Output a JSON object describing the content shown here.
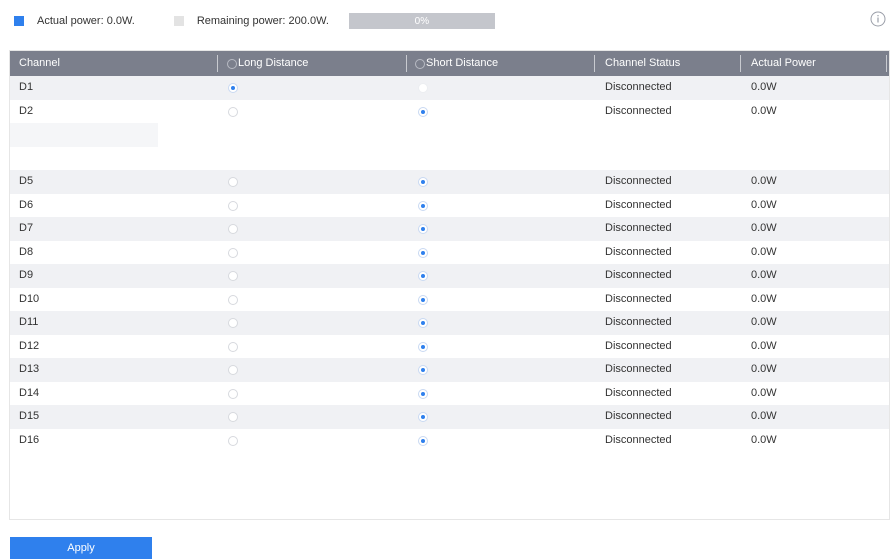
{
  "legend": {
    "actual_label": "Actual power: 0.0W.",
    "remaining_label": "Remaining power: 200.0W.",
    "progress_text": "0%",
    "progress_fraction": 0.0,
    "actual_color": "#2f80ed",
    "remaining_color": "#e3e3e3",
    "info_icon": "info-circle-icon"
  },
  "table": {
    "headers": {
      "channel": "Channel",
      "long_distance": "Long Distance",
      "short_distance": "Short Distance",
      "status": "Channel Status",
      "actual_power": "Actual Power"
    },
    "rows": [
      {
        "channel": "D1",
        "mode": "long",
        "status": "Disconnected",
        "power": "0.0W",
        "short_disabled": true
      },
      {
        "channel": "D2",
        "mode": "short",
        "status": "Disconnected",
        "power": "0.0W"
      },
      {
        "channel": "",
        "blank": true
      },
      {
        "channel": "",
        "blank": true
      },
      {
        "channel": "D5",
        "mode": "short",
        "status": "Disconnected",
        "power": "0.0W"
      },
      {
        "channel": "D6",
        "mode": "short",
        "status": "Disconnected",
        "power": "0.0W"
      },
      {
        "channel": "D7",
        "mode": "short",
        "status": "Disconnected",
        "power": "0.0W"
      },
      {
        "channel": "D8",
        "mode": "short",
        "status": "Disconnected",
        "power": "0.0W"
      },
      {
        "channel": "D9",
        "mode": "short",
        "status": "Disconnected",
        "power": "0.0W"
      },
      {
        "channel": "D10",
        "mode": "short",
        "status": "Disconnected",
        "power": "0.0W"
      },
      {
        "channel": "D11",
        "mode": "short",
        "status": "Disconnected",
        "power": "0.0W"
      },
      {
        "channel": "D12",
        "mode": "short",
        "status": "Disconnected",
        "power": "0.0W"
      },
      {
        "channel": "D13",
        "mode": "short",
        "status": "Disconnected",
        "power": "0.0W"
      },
      {
        "channel": "D14",
        "mode": "short",
        "status": "Disconnected",
        "power": "0.0W"
      },
      {
        "channel": "D15",
        "mode": "short",
        "status": "Disconnected",
        "power": "0.0W"
      },
      {
        "channel": "D16",
        "mode": "short",
        "status": "Disconnected",
        "power": "0.0W"
      }
    ]
  },
  "apply_label": "Apply"
}
